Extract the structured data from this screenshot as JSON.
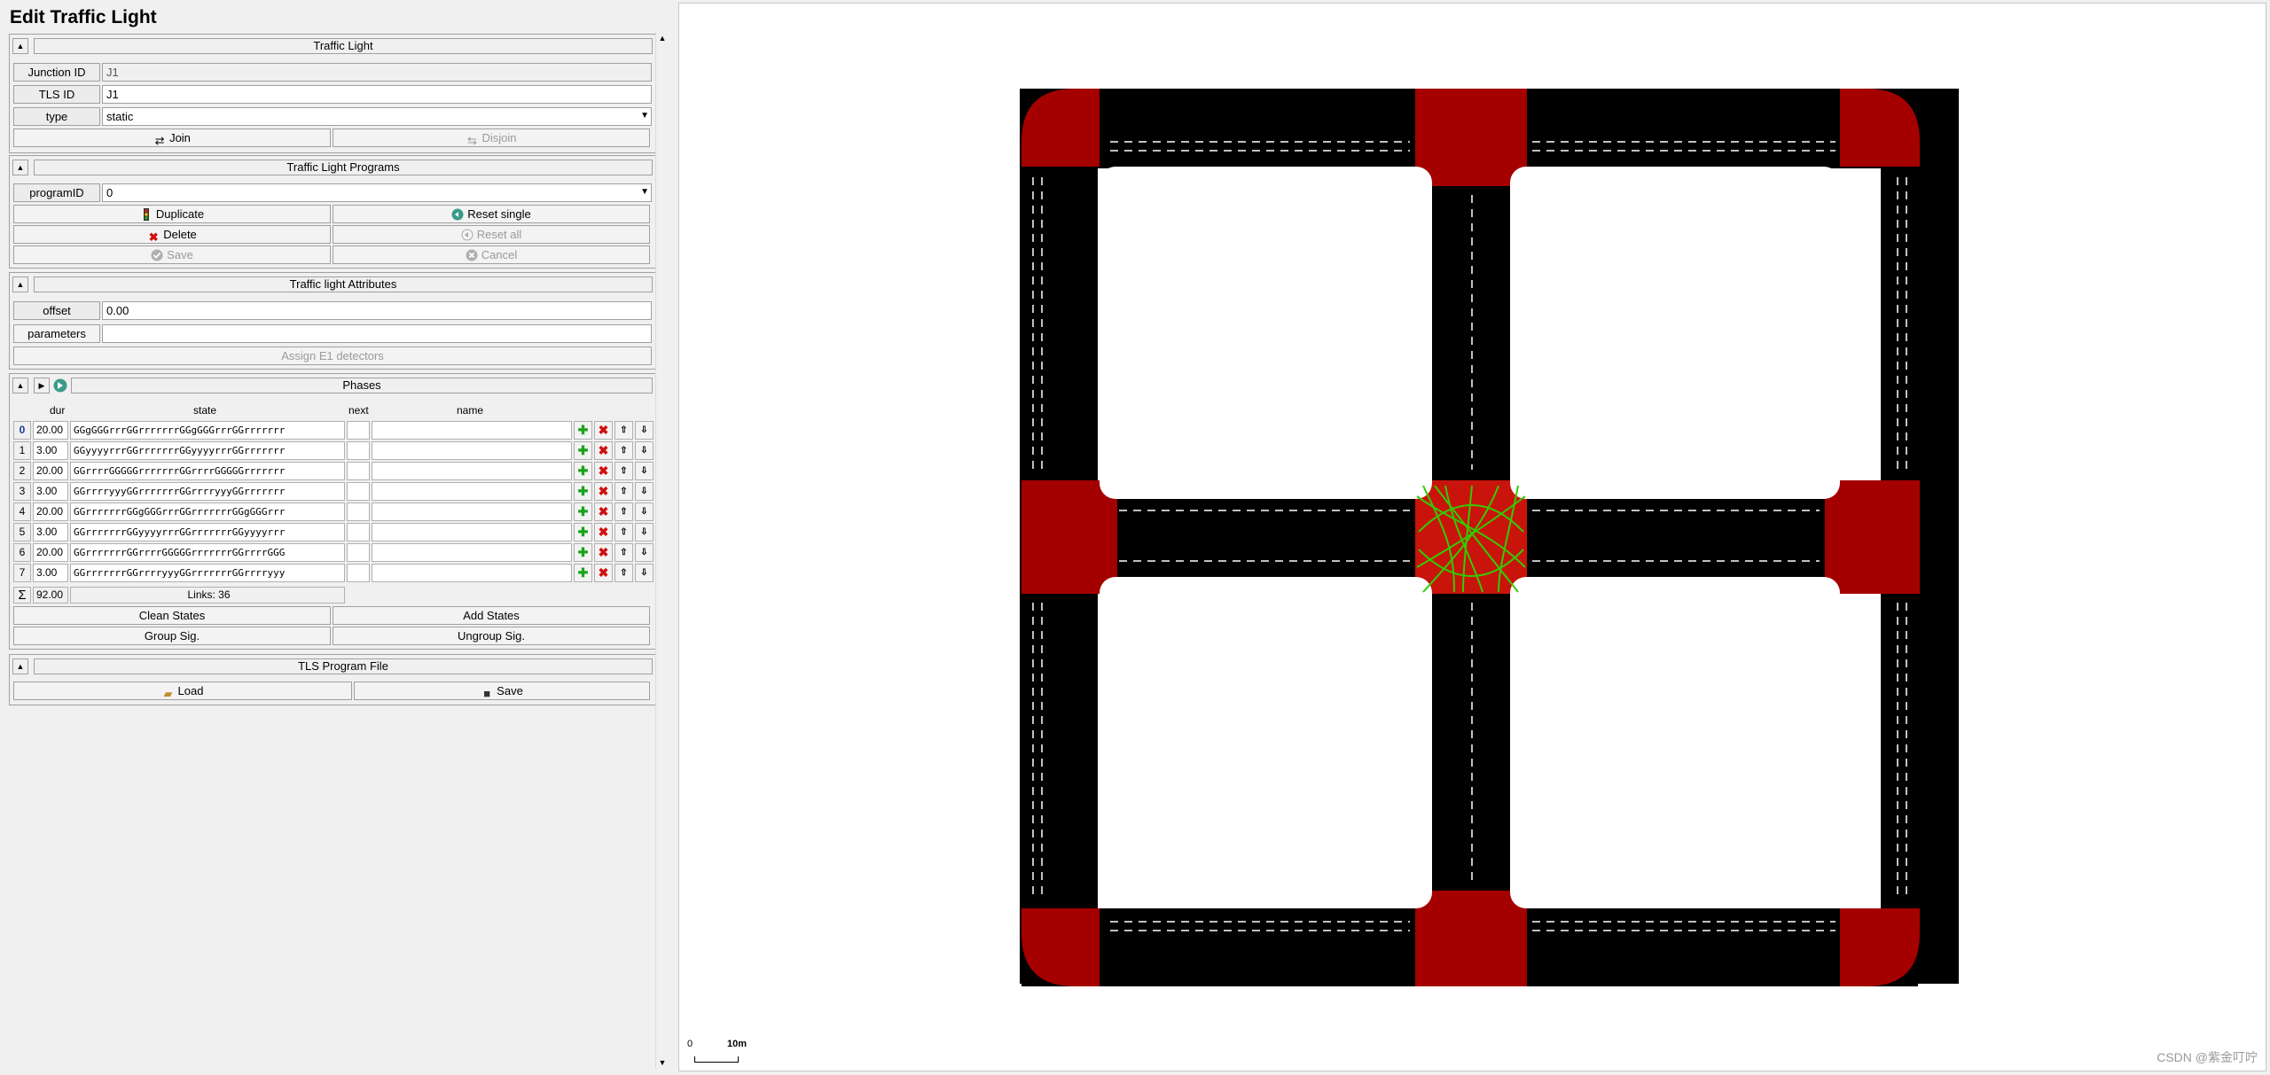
{
  "panel": {
    "title": "Edit Traffic Light"
  },
  "traffic_light": {
    "title": "Traffic Light",
    "junction_label": "Junction ID",
    "junction_value": "J1",
    "tls_label": "TLS ID",
    "tls_value": "J1",
    "type_label": "type",
    "type_value": "static",
    "join_label": "Join",
    "disjoin_label": "Disjoin"
  },
  "programs": {
    "title": "Traffic Light Programs",
    "program_label": "programID",
    "program_value": "0",
    "duplicate_label": "Duplicate",
    "reset_single_label": "Reset single",
    "delete_label": "Delete",
    "reset_all_label": "Reset all",
    "save_label": "Save",
    "cancel_label": "Cancel"
  },
  "attributes": {
    "title": "Traffic light Attributes",
    "offset_label": "offset",
    "offset_value": "0.00",
    "parameters_label": "parameters",
    "parameters_value": "",
    "assign_label": "Assign E1 detectors"
  },
  "phases": {
    "title": "Phases",
    "col_dur": "dur",
    "col_state": "state",
    "col_next": "next",
    "col_name": "name",
    "rows": [
      {
        "index": "0",
        "dur": "20.00",
        "state": "GGgGGGrrrGGrrrrrrrGGgGGGrrrGGrrrrrrr"
      },
      {
        "index": "1",
        "dur": "3.00",
        "state": "GGyyyyrrrGGrrrrrrrGGyyyyrrrGGrrrrrrr"
      },
      {
        "index": "2",
        "dur": "20.00",
        "state": "GGrrrrGGGGGrrrrrrrGGrrrrGGGGGrrrrrrr"
      },
      {
        "index": "3",
        "dur": "3.00",
        "state": "GGrrrryyyGGrrrrrrrGGrrrryyyGGrrrrrrr"
      },
      {
        "index": "4",
        "dur": "20.00",
        "state": "GGrrrrrrrGGgGGGrrrGGrrrrrrrGGgGGGrrr"
      },
      {
        "index": "5",
        "dur": "3.00",
        "state": "GGrrrrrrrGGyyyyrrrGGrrrrrrrGGyyyyrrr"
      },
      {
        "index": "6",
        "dur": "20.00",
        "state": "GGrrrrrrrGGrrrrGGGGGrrrrrrrGGrrrrGGG"
      },
      {
        "index": "7",
        "dur": "3.00",
        "state": "GGrrrrrrrGGrrrryyyGGrrrrrrrGGrrrryyy"
      }
    ],
    "total_dur": "92.00",
    "links": "Links: 36",
    "clean_label": "Clean States",
    "add_label": "Add States",
    "group_label": "Group Sig.",
    "ungroup_label": "Ungroup Sig."
  },
  "program_file": {
    "title": "TLS Program File",
    "load_label": "Load",
    "save_label": "Save"
  },
  "scale": {
    "zero": "0",
    "ten": "10m"
  },
  "watermark": "CSDN @紫金叮咛",
  "colors": {
    "road": "#000000",
    "junction": "#a50000",
    "link_green": "#33cc00"
  }
}
